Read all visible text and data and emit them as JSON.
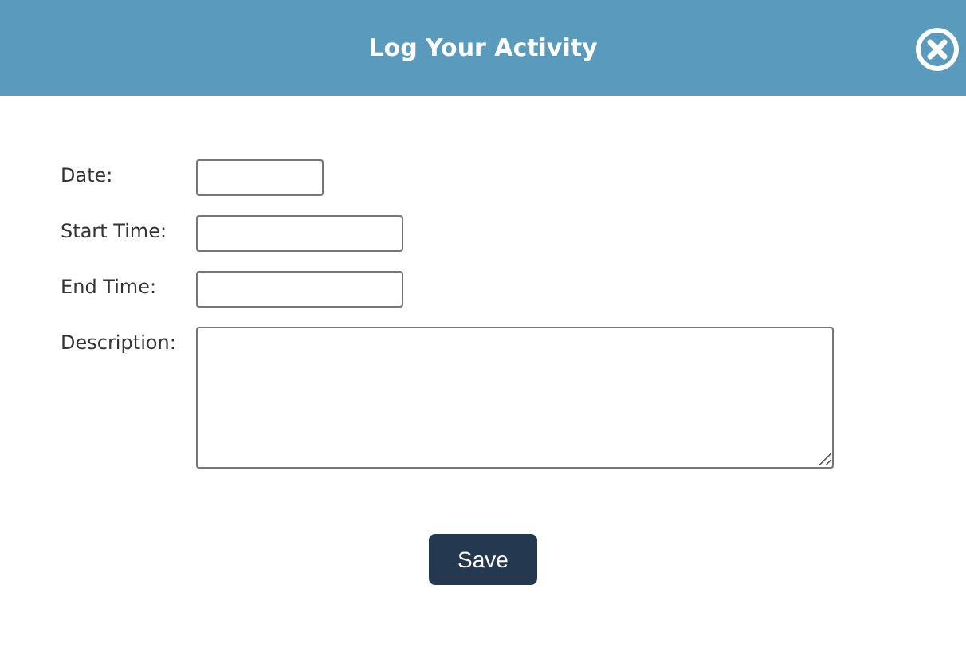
{
  "dialog": {
    "title": "Log Your Activity"
  },
  "fields": [
    {
      "label": "Date:",
      "kind": "date"
    },
    {
      "label": "Start Time:",
      "kind": "time"
    },
    {
      "label": "End Time:",
      "kind": "time"
    },
    {
      "label": "Description:",
      "kind": "textarea"
    }
  ],
  "buttons": [
    "Save"
  ]
}
